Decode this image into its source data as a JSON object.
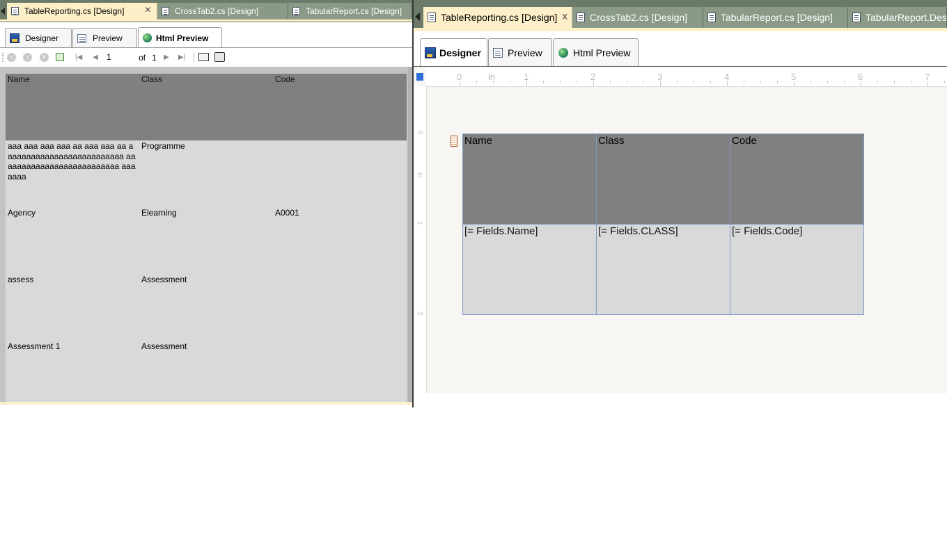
{
  "left_window": {
    "doc_tabs": [
      {
        "label": "TableReporting.cs [Design]",
        "active": true,
        "close": "×"
      },
      {
        "label": "CrossTab2.cs [Design]",
        "active": false
      },
      {
        "label": "TabularReport.cs [Design]",
        "active": false
      }
    ],
    "view_tabs": [
      {
        "label": "Designer",
        "icon": "designer-icon",
        "active": false
      },
      {
        "label": "Preview",
        "icon": "preview-icon",
        "active": false
      },
      {
        "label": "Html Preview",
        "icon": "globe-icon",
        "active": true
      }
    ],
    "toolbar": {
      "page_number": "1",
      "of_label": "of",
      "total_pages": "1"
    },
    "preview_table": {
      "columns": [
        "Name",
        "Class",
        "Code"
      ],
      "rows": [
        {
          "name": "aaa aaa aaa aaa aa aaa aaa aa aaaaaaaaaaaaaaaaaaaaaaaaaa aaaaaaaaaaaaaaaaaaaaaaaaaa aaaaaaa",
          "class": "Programme",
          "code": ""
        },
        {
          "name": "Agency",
          "class": "Elearning",
          "code": "A0001"
        },
        {
          "name": "assess",
          "class": "Assessment",
          "code": ""
        },
        {
          "name": "Assessment 1",
          "class": "Assessment",
          "code": ""
        }
      ]
    }
  },
  "right_window": {
    "doc_tabs": [
      {
        "label": "TableReporting.cs [Design]",
        "active": true,
        "close": "x"
      },
      {
        "label": "CrossTab2.cs [Design]",
        "active": false
      },
      {
        "label": "TabularReport.cs [Design]",
        "active": false
      },
      {
        "label": "TabularReport.Designer",
        "active": false
      }
    ],
    "view_tabs": [
      {
        "label": "Designer",
        "icon": "designer-icon",
        "active": true
      },
      {
        "label": "Preview",
        "icon": "preview-icon",
        "active": false
      },
      {
        "label": "Html Preview",
        "icon": "globe-icon",
        "active": false
      }
    ],
    "ruler": {
      "labels": [
        "0",
        "in",
        "1",
        "2",
        "3",
        "4",
        "5",
        "6",
        "7"
      ],
      "v_labels": [
        "0",
        "in",
        "1",
        "2"
      ]
    },
    "design_table": {
      "header": [
        "Name",
        "Class",
        "Code"
      ],
      "detail": [
        "[= Fields.Name]",
        "[= Fields.CLASS]",
        "[= Fields.Code]"
      ]
    }
  },
  "colors": {
    "tab_active": "#fdf0c8",
    "tab_inactive": "#8a9a87",
    "header_fill": "#808080",
    "detail_fill": "#d9d9d9",
    "selection_border": "#7f99c8"
  }
}
